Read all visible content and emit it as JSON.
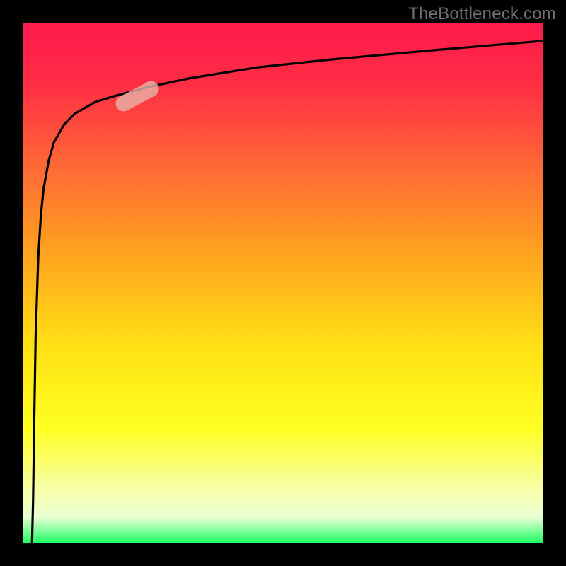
{
  "watermark_text": "TheBottleneck.com",
  "colors": {
    "frame": "#000000",
    "watermark": "#707070",
    "curve": "#000000",
    "marker": "rgba(232,176,165,0.82)",
    "gradient_stops": [
      {
        "offset": 0.0,
        "color": "#ff1a4b"
      },
      {
        "offset": 0.12,
        "color": "#ff2e44"
      },
      {
        "offset": 0.28,
        "color": "#ff6a34"
      },
      {
        "offset": 0.45,
        "color": "#ffa51f"
      },
      {
        "offset": 0.62,
        "color": "#ffe014"
      },
      {
        "offset": 0.78,
        "color": "#ffff22"
      },
      {
        "offset": 0.9,
        "color": "#f7ffae"
      },
      {
        "offset": 0.95,
        "color": "#e8ffd0"
      },
      {
        "offset": 1.0,
        "color": "#1aff66"
      }
    ]
  },
  "chart_data": {
    "type": "line",
    "title": "",
    "xlabel": "",
    "ylabel": "",
    "xlim": [
      0,
      100
    ],
    "ylim": [
      0,
      100
    ],
    "grid": false,
    "annotation": "Single logarithmic-style curve: starts near (≈2, 0), rises nearly vertically, then asymptotes toward y≈97 across x. A pink oblong marker highlights the region around x≈18–26, y≈84–87.",
    "series": [
      {
        "name": "curve",
        "x": [
          1.8,
          2.0,
          2.2,
          2.5,
          3.0,
          3.5,
          4.0,
          5.0,
          6.0,
          8.0,
          10.0,
          14.0,
          18.0,
          24.0,
          32.0,
          45.0,
          60.0,
          80.0,
          100.0
        ],
        "y": [
          0.0,
          8.0,
          22.0,
          40.0,
          55.0,
          63.0,
          68.0,
          73.5,
          77.0,
          80.5,
          82.5,
          84.8,
          86.0,
          87.6,
          89.3,
          91.4,
          93.0,
          94.8,
          96.5
        ]
      }
    ],
    "marker": {
      "x": 22.0,
      "y": 85.8,
      "angle_deg": -28,
      "length_x": 9,
      "height_y": 3
    }
  }
}
